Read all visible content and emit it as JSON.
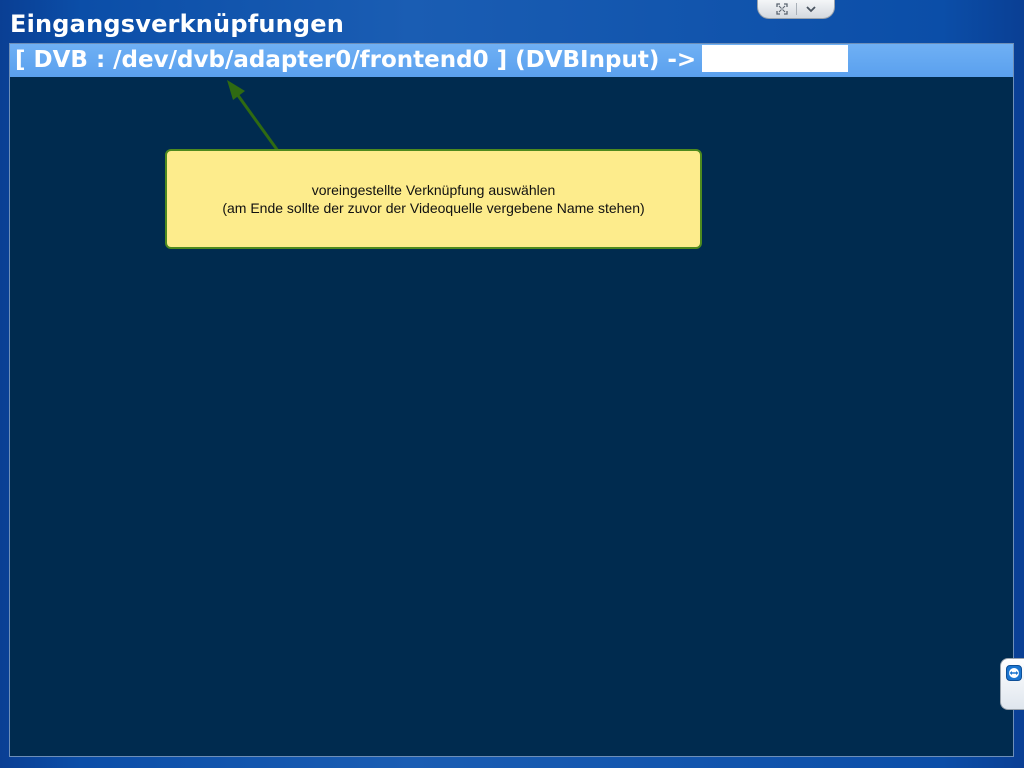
{
  "page": {
    "title": "Eingangsverknüpfungen"
  },
  "remote_toolbar": {
    "fullscreen_icon": "fullscreen-icon",
    "chevron_icon": "chevron-down-icon"
  },
  "list": {
    "selected_row": {
      "label": "[ DVB : /dev/dvb/adapter0/frontend0 ] (DVBInput) ->"
    }
  },
  "callout": {
    "line1": "voreingestellte Verknüpfung auswählen",
    "line2": "(am Ende sollte der zuvor der Videoquelle vergebene Name stehen)"
  },
  "colors": {
    "panel_bg": "#002b4f",
    "row_highlight": "#5fa4f0",
    "callout_bg": "#fdec8c",
    "callout_border": "#4e8a1e",
    "arrow": "#2f6a12"
  },
  "side_tab": {
    "icon": "teamviewer-icon"
  }
}
